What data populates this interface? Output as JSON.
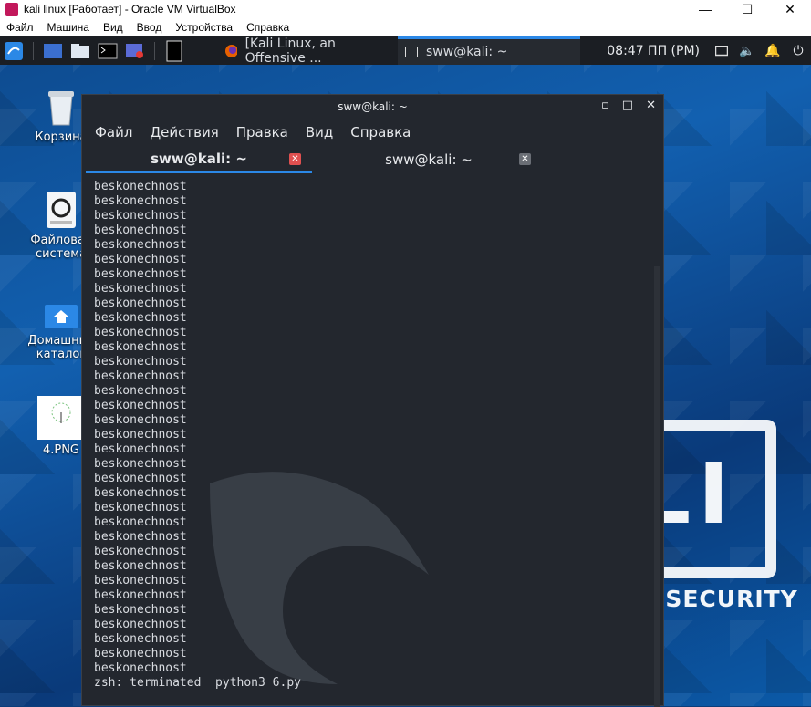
{
  "vbox": {
    "title": "kali linux [Работает] - Oracle VM VirtualBox",
    "menu": [
      "Файл",
      "Машина",
      "Вид",
      "Ввод",
      "Устройства",
      "Справка"
    ]
  },
  "panel": {
    "tasks": [
      {
        "label": "[Kali Linux, an Offensive ...",
        "icon": "firefox-icon"
      },
      {
        "label": "sww@kali: ~",
        "icon": "terminal-icon"
      }
    ],
    "clock": "08:47 ПП (PM)"
  },
  "desktop": {
    "icons": [
      {
        "label": "Корзина",
        "icon": "trash-icon"
      },
      {
        "label": "Файловая система",
        "icon": "filesystem-icon"
      },
      {
        "label": "Домашний каталог",
        "icon": "home-icon"
      },
      {
        "label": "4.PNG",
        "icon": "image-icon"
      }
    ],
    "wallpaper": {
      "logo": "KALI",
      "tagline": "BY OFFENSIVE SECURITY"
    }
  },
  "terminal": {
    "title": "sww@kali: ~",
    "menu": [
      "Файл",
      "Действия",
      "Правка",
      "Вид",
      "Справка"
    ],
    "tabs": [
      "sww@kali: ~",
      "sww@kali: ~"
    ],
    "repeat_line": "beskonechnost",
    "repeat_count": 34,
    "last_line": "zsh: terminated  python3 6.py"
  },
  "colors": {
    "accent": "#2b88e6",
    "panel": "#1b1e23",
    "terminal_bg": "#23272e"
  }
}
